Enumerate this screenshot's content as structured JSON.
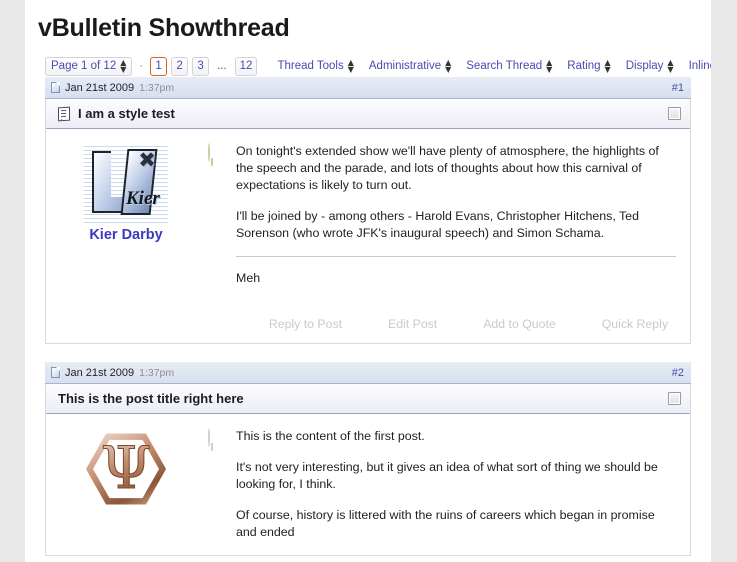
{
  "page": {
    "title": "vBulletin Showthread"
  },
  "toolbar": {
    "page_selector": "Page 1 of 12",
    "separator": "·",
    "pages": [
      "1",
      "2",
      "3",
      "...",
      "12"
    ],
    "current_page": "1",
    "menus": [
      {
        "label": "Thread Tools"
      },
      {
        "label": "Administrative"
      },
      {
        "label": "Search Thread"
      },
      {
        "label": "Rating"
      },
      {
        "label": "Display"
      },
      {
        "label": "Inline Mod"
      }
    ]
  },
  "posts": [
    {
      "date": "Jan 21st 2009",
      "time": "1:37pm",
      "number": "#1",
      "title": "I am a style test",
      "username": "Kier Darby",
      "paragraphs": [
        "On tonight's extended show we'll have plenty of atmosphere, the highlights of the speech and the parade, and lots of thoughts about how this carnival of expectations is likely to turn out.",
        "I'll be joined by - among others - Harold Evans, Christopher Hitchens, Ted Sorenson (who wrote JFK's inaugural speech) and Simon Schama."
      ],
      "signature": "Meh",
      "actions": [
        "Reply to Post",
        "Edit Post",
        "Add to Quote",
        "Quick Reply"
      ]
    },
    {
      "date": "Jan 21st 2009",
      "time": "1:37pm",
      "number": "#2",
      "title": "This is the post title right here",
      "username": "",
      "paragraphs": [
        "This is the content of the first post.",
        "It's not very interesting, but it gives an idea of what sort of thing we should be looking for, I think.",
        "Of course, history is littered with the ruins of careers which began in promise and ended"
      ]
    }
  ],
  "colors": {
    "link": "#4a4ab0",
    "username": "#3a3ac0",
    "current_page_border": "#e2600d",
    "post_header_bg": "#dde4f1",
    "action_text": "#c9c9cf",
    "page_bg": "#e9e9e9"
  }
}
